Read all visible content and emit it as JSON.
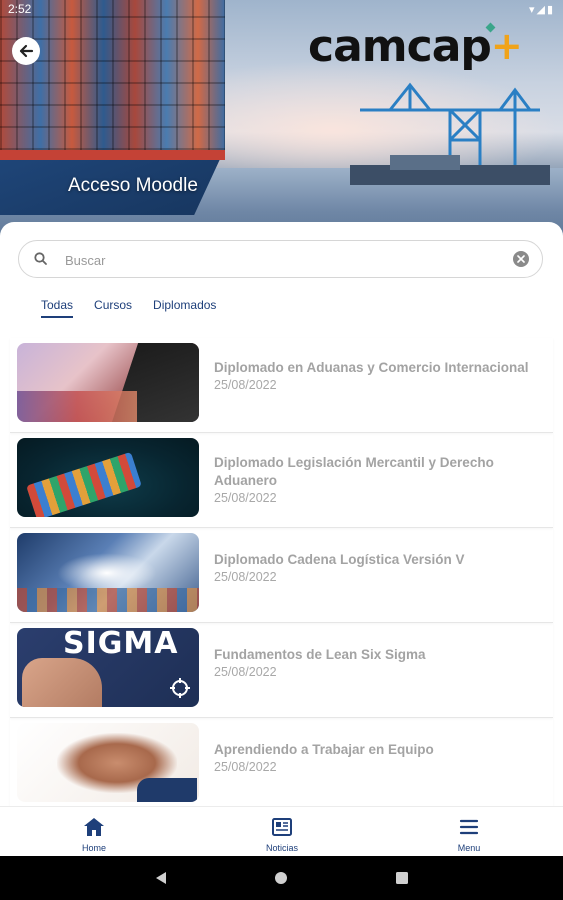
{
  "status_bar": {
    "time": "2:52"
  },
  "brand": {
    "logo_text": "camcap",
    "logo_plus": "+"
  },
  "hero": {
    "title": "Acceso Moodle"
  },
  "search": {
    "placeholder": "Buscar",
    "value": ""
  },
  "tabs": [
    {
      "label": "Todas",
      "active": true
    },
    {
      "label": "Cursos",
      "active": false
    },
    {
      "label": "Diplomados",
      "active": false
    }
  ],
  "courses": [
    {
      "title": "Diplomado en Aduanas y Comercio Internacional",
      "date": "25/08/2022"
    },
    {
      "title": "Diplomado Legislación Mercantil y Derecho Aduanero",
      "date": "25/08/2022"
    },
    {
      "title": "Diplomado Cadena Logística Versión V",
      "date": "25/08/2022"
    },
    {
      "title": "Fundamentos de Lean Six Sigma",
      "date": "25/08/2022"
    },
    {
      "title": "Aprendiendo a Trabajar en Equipo",
      "date": "25/08/2022"
    }
  ],
  "thumb_text": {
    "sigma": "SIGMA"
  },
  "bottom_nav": [
    {
      "label": "Home",
      "icon": "home-icon"
    },
    {
      "label": "Noticias",
      "icon": "newspaper-icon"
    },
    {
      "label": "Menu",
      "icon": "menu-icon"
    }
  ],
  "colors": {
    "primary": "#1e3f7a",
    "accent": "#f0a31a",
    "muted_text": "#a3a3a3"
  }
}
